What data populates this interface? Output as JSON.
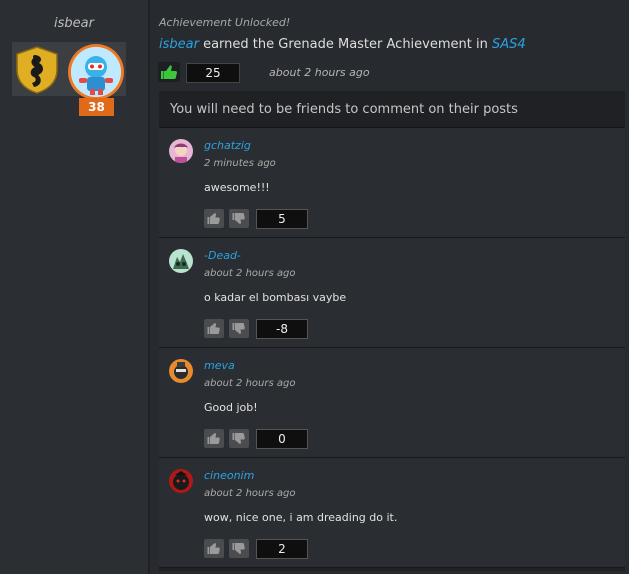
{
  "profile": {
    "username": "isbear",
    "level": "38"
  },
  "post": {
    "label": "Achievement Unlocked!",
    "user": "isbear",
    "text_middle": " earned the Grenade Master Achievement in ",
    "game": "SAS4",
    "likes": "25",
    "time": "about 2 hours ago",
    "like_color": "#3ec53e"
  },
  "comments_panel": {
    "notice": "You will need to be friends to comment on their posts",
    "comments": [
      {
        "user": "gchatzig",
        "time": "2 minutes ago",
        "text": "awesome!!!",
        "score": "5"
      },
      {
        "user": "-Dead-",
        "time": "about 2 hours ago",
        "text": "o kadar el bombası vaybe",
        "score": "-8"
      },
      {
        "user": "meva",
        "time": "about 2 hours ago",
        "text": "Good job!",
        "score": "0"
      },
      {
        "user": "cineonim",
        "time": "about 2 hours ago",
        "text": "wow, nice one, i am dreading do it.",
        "score": "2"
      }
    ]
  },
  "colors": {
    "link": "#2aa3e3",
    "level_badge": "#e06a1a",
    "background": "#272a2e"
  }
}
